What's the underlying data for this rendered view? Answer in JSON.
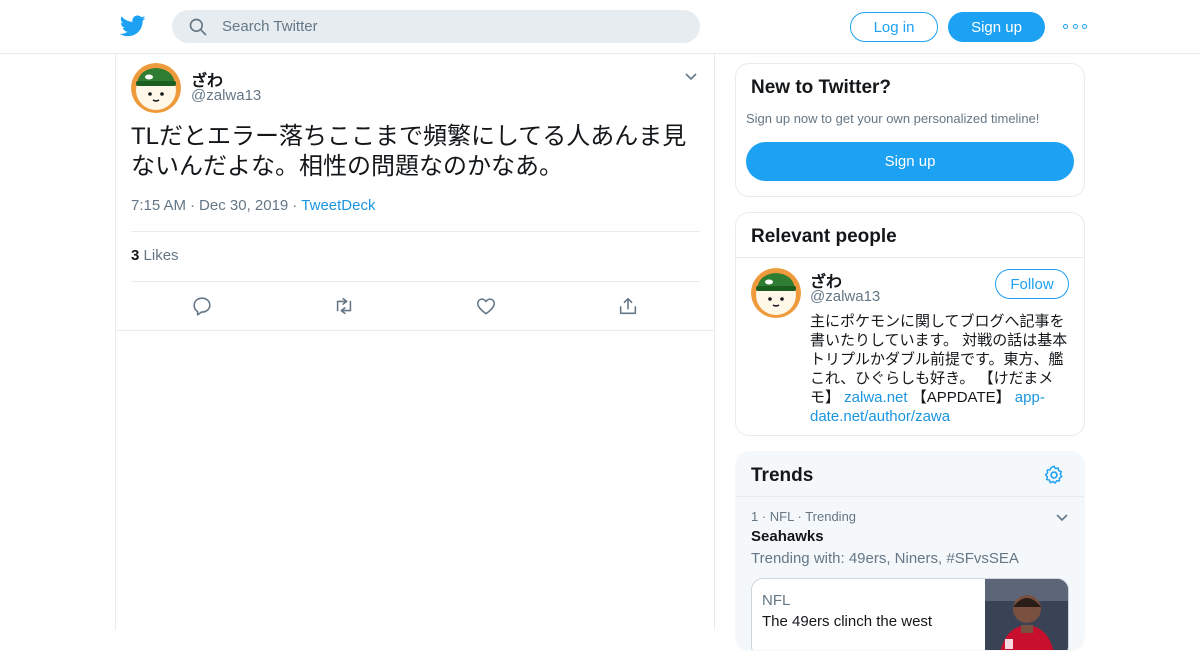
{
  "header": {
    "search_placeholder": "Search Twitter",
    "login_label": "Log in",
    "signup_label": "Sign up",
    "accent_color": "#1da1f2"
  },
  "tweet": {
    "display_name": "ざわ",
    "handle": "@zalwa13",
    "text": "TLだとエラー落ちここまで頻繁にしてる人あんま見ないんだよな。相性の問題なのかなあ。",
    "time": "7:15 AM",
    "date": "Dec 30, 2019",
    "source": "TweetDeck",
    "likes_count": "3",
    "likes_label": "Likes",
    "actions": [
      "reply-icon",
      "retweet-icon",
      "like-icon",
      "share-icon"
    ]
  },
  "new_to_twitter": {
    "title": "New to Twitter?",
    "subtitle": "Sign up now to get your own personalized timeline!",
    "signup_label": "Sign up"
  },
  "relevant_people": {
    "title": "Relevant people",
    "person": {
      "display_name": "ざわ",
      "handle": "@zalwa13",
      "follow_label": "Follow",
      "bio_text": "主にポケモンに関してブログへ記事を書いたりしています。 対戦の話は基本トリプルかダブル前提です。東方、艦これ、ひぐらしも好き。 【けだまメモ】 ",
      "bio_link1": "zalwa.net",
      "bio_mid": " 【APPDATE】 ",
      "bio_link2": "app-date.net/author/zawa"
    }
  },
  "trends": {
    "title": "Trends",
    "items": [
      {
        "rank": "1",
        "category": "NFL",
        "status": "Trending",
        "name": "Seahawks",
        "with": "Trending with: 49ers, Niners, #SFvsSEA",
        "news_source": "NFL",
        "news_headline": "The 49ers clinch the west"
      }
    ]
  }
}
